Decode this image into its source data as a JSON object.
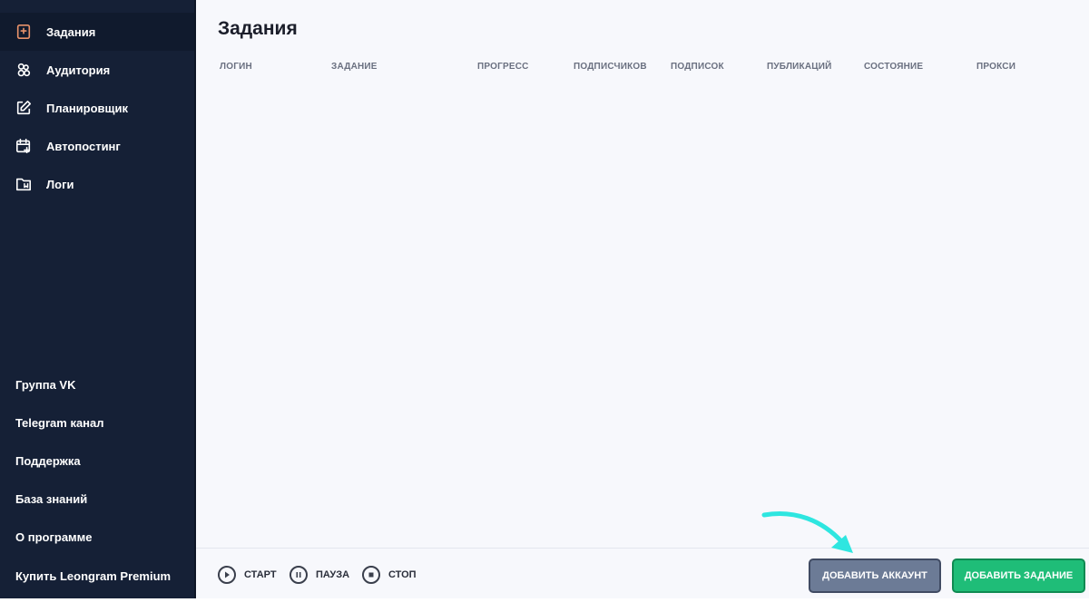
{
  "sidebar": {
    "items": [
      {
        "label": "Задания",
        "icon": "bookmark-plus-icon",
        "active": true
      },
      {
        "label": "Аудитория",
        "icon": "users-icon",
        "active": false
      },
      {
        "label": "Планировщик",
        "icon": "edit-icon",
        "active": false
      },
      {
        "label": "Автопостинг",
        "icon": "calendar-plus-icon",
        "active": false
      },
      {
        "label": "Логи",
        "icon": "folder-icon",
        "active": false
      }
    ],
    "links": [
      {
        "label": "Группа VK"
      },
      {
        "label": "Telegram канал"
      },
      {
        "label": "Поддержка"
      },
      {
        "label": "База знаний"
      },
      {
        "label": "О программе"
      },
      {
        "label": "Купить Leongram Premium"
      }
    ]
  },
  "main": {
    "title": "Задания",
    "columns": [
      "Логин",
      "Задание",
      "Прогресс",
      "Подписчиков",
      "Подписок",
      "Публикаций",
      "Состояние",
      "Прокси"
    ]
  },
  "footer": {
    "start_label": "Старт",
    "pause_label": "Пауза",
    "stop_label": "Стоп",
    "add_account_label": "Добавить аккаунт",
    "add_task_label": "Добавить задание"
  },
  "colors": {
    "sidebar_bg": "#152036",
    "active_icon": "#e8926a",
    "add_account_bg": "#6c7b96",
    "add_task_bg": "#1fbd78",
    "arrow": "#2ee6e0"
  }
}
